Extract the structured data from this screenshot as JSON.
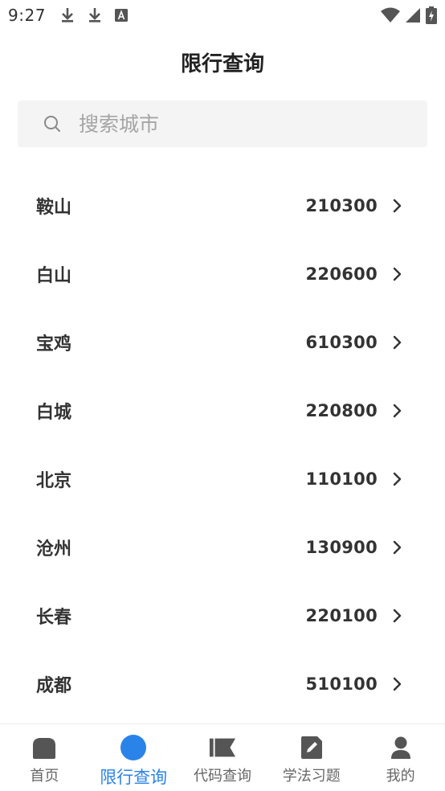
{
  "status_bar": {
    "time": "9:27",
    "left_icons": [
      "download-icon",
      "download-icon",
      "text-a-icon"
    ],
    "right_icons": [
      "wifi-icon",
      "signal-icon",
      "battery-charging-icon"
    ]
  },
  "header": {
    "title": "限行查询"
  },
  "search": {
    "placeholder": "搜索城市",
    "value": "",
    "icon": "search-icon"
  },
  "cities": [
    {
      "name": "鞍山",
      "code": "210300"
    },
    {
      "name": "白山",
      "code": "220600"
    },
    {
      "name": "宝鸡",
      "code": "610300"
    },
    {
      "name": "白城",
      "code": "220800"
    },
    {
      "name": "北京",
      "code": "110100"
    },
    {
      "name": "沧州",
      "code": "130900"
    },
    {
      "name": "长春",
      "code": "220100"
    },
    {
      "name": "成都",
      "code": "510100"
    }
  ],
  "tabs": [
    {
      "label": "首页",
      "icon": "home-icon",
      "active": false
    },
    {
      "label": "限行查询",
      "icon": "circle-icon",
      "active": true
    },
    {
      "label": "代码查询",
      "icon": "flag-icon",
      "active": false
    },
    {
      "label": "学法习题",
      "icon": "edit-icon",
      "active": false
    },
    {
      "label": "我的",
      "icon": "user-icon",
      "active": false
    }
  ],
  "colors": {
    "accent": "#2a83e8",
    "text": "#333333",
    "muted": "#666666",
    "search_bg": "#f4f4f5"
  }
}
